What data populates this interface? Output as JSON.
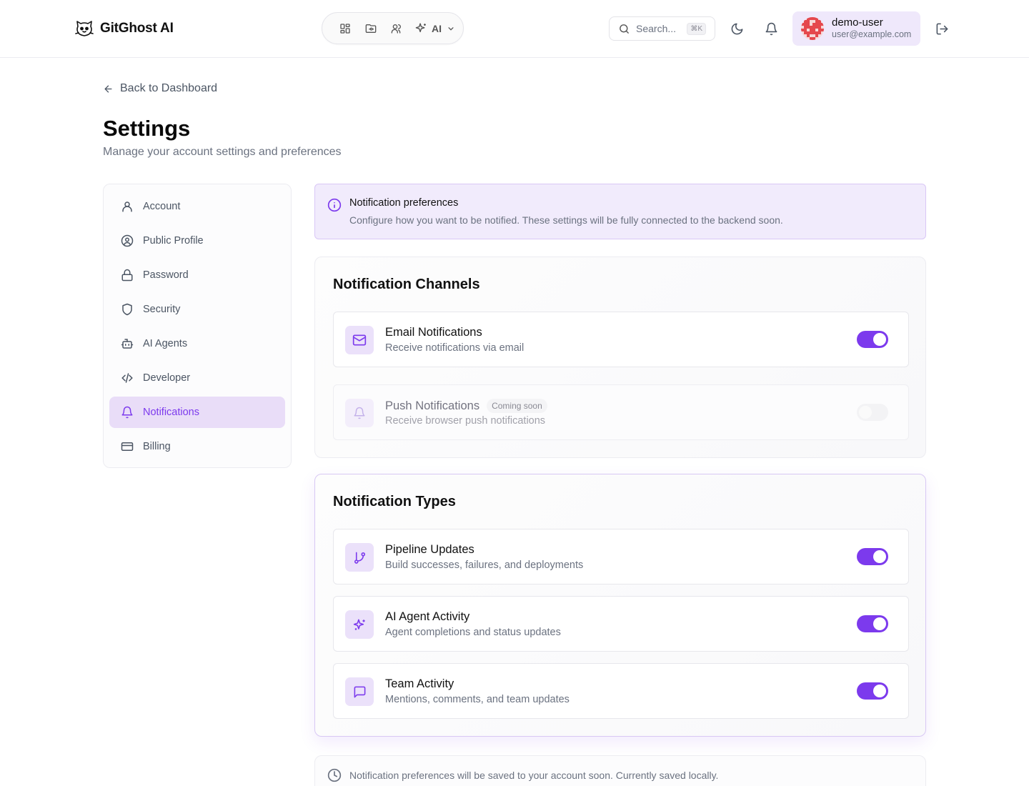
{
  "header": {
    "app_name": "GitGhost AI",
    "nav_ai_label": "AI",
    "search_placeholder": "Search...",
    "search_shortcut": "⌘K",
    "user_name": "demo-user",
    "user_email": "user@example.com"
  },
  "page": {
    "back_label": "Back to Dashboard",
    "title": "Settings",
    "subtitle": "Manage your account settings and preferences"
  },
  "sidebar": {
    "items": [
      {
        "label": "Account",
        "icon": "user-icon",
        "active": false
      },
      {
        "label": "Public Profile",
        "icon": "user-circle-icon",
        "active": false
      },
      {
        "label": "Password",
        "icon": "lock-icon",
        "active": false
      },
      {
        "label": "Security",
        "icon": "shield-icon",
        "active": false
      },
      {
        "label": "AI Agents",
        "icon": "bot-icon",
        "active": false
      },
      {
        "label": "Developer",
        "icon": "code-icon",
        "active": false
      },
      {
        "label": "Notifications",
        "icon": "bell-icon",
        "active": true
      },
      {
        "label": "Billing",
        "icon": "credit-card-icon",
        "active": false
      }
    ]
  },
  "banner": {
    "title": "Notification preferences",
    "text": "Configure how you want to be notified. These settings will be fully connected to the backend soon."
  },
  "channels": {
    "title": "Notification Channels",
    "items": [
      {
        "title": "Email Notifications",
        "desc": "Receive notifications via email",
        "enabled": true,
        "icon": "mail-icon"
      },
      {
        "title": "Push Notifications",
        "badge": "Coming soon",
        "desc": "Receive browser push notifications",
        "enabled": false,
        "icon": "bell-icon"
      }
    ]
  },
  "types": {
    "title": "Notification Types",
    "items": [
      {
        "title": "Pipeline Updates",
        "desc": "Build successes, failures, and deployments",
        "enabled": true,
        "icon": "git-branch-icon"
      },
      {
        "title": "AI Agent Activity",
        "desc": "Agent completions and status updates",
        "enabled": true,
        "icon": "sparkles-icon"
      },
      {
        "title": "Team Activity",
        "desc": "Mentions, comments, and team updates",
        "enabled": true,
        "icon": "message-square-icon"
      }
    ]
  },
  "footnote": {
    "text": "Notification preferences will be saved to your account soon. Currently saved locally."
  },
  "colors": {
    "accent": "#7c3aed",
    "active_bg": "#e9ddf8",
    "banner_bg": "#f1ebfc"
  }
}
